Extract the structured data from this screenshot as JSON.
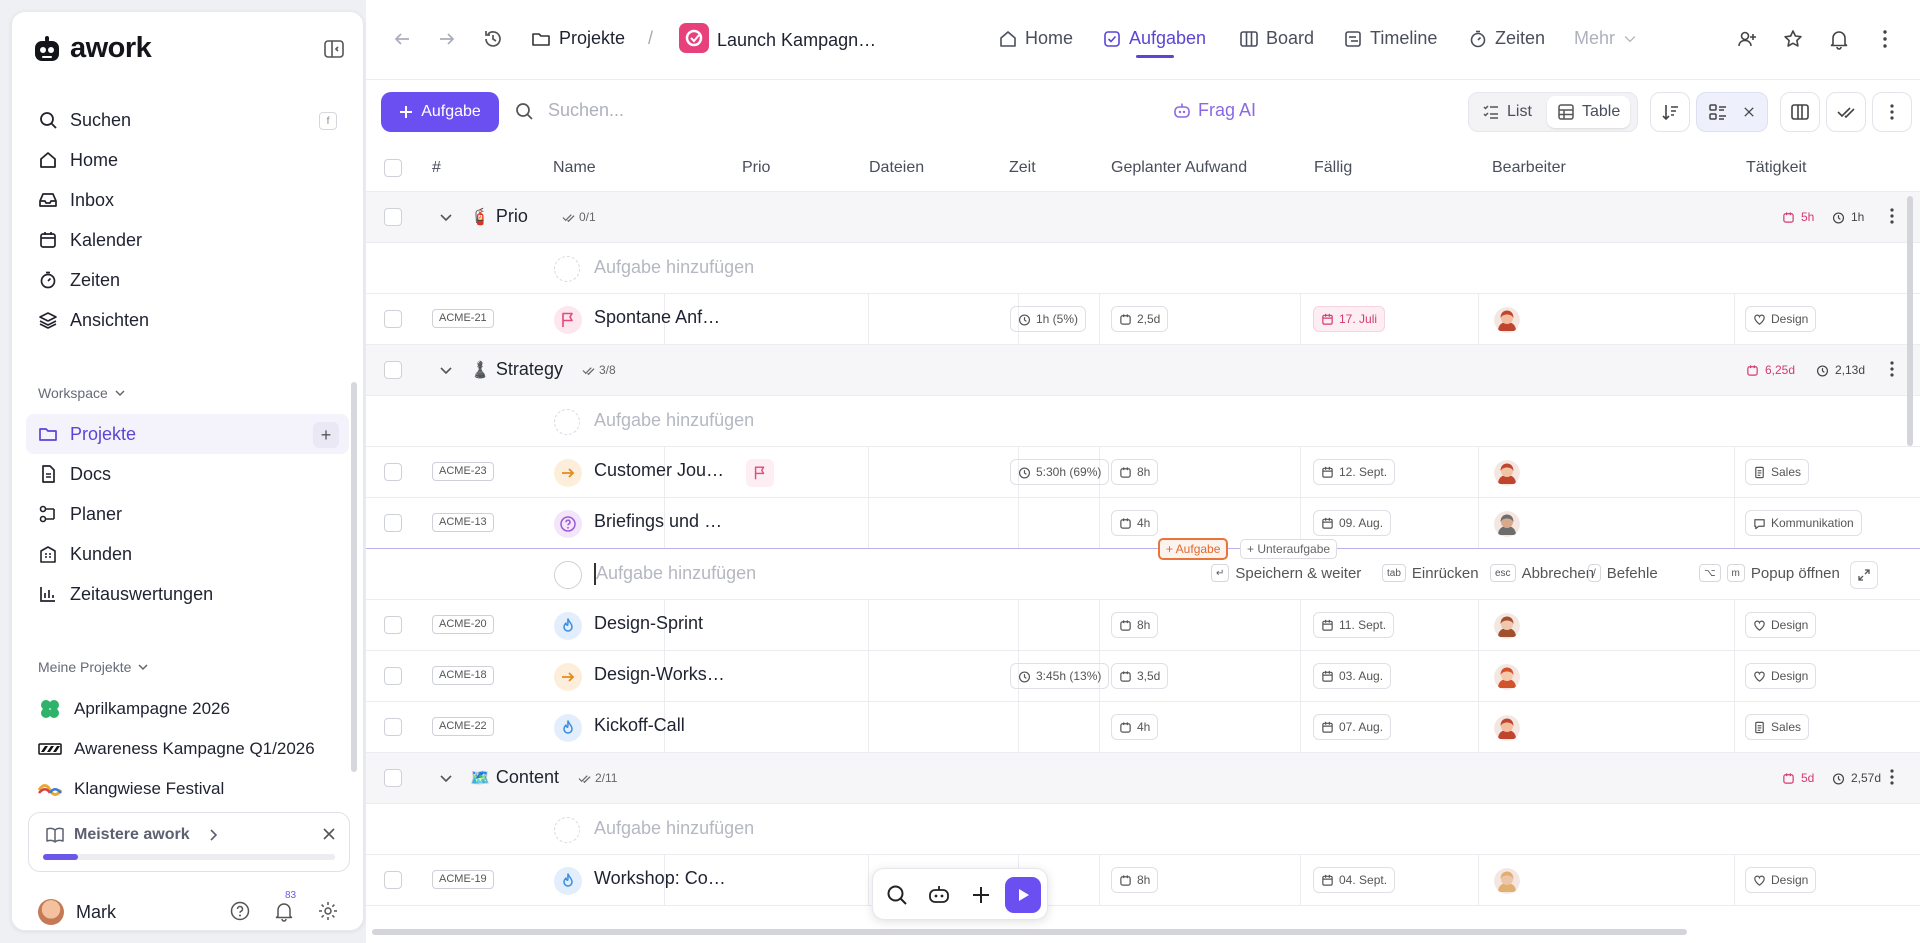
{
  "brand": {
    "name": "awork"
  },
  "sidebar": {
    "search": {
      "label": "Suchen",
      "shortcut": "f"
    },
    "items": [
      {
        "label": "Home",
        "icon": "home-icon"
      },
      {
        "label": "Inbox",
        "icon": "inbox-icon"
      },
      {
        "label": "Kalender",
        "icon": "calendar-icon"
      },
      {
        "label": "Zeiten",
        "icon": "timer-icon"
      },
      {
        "label": "Ansichten",
        "icon": "layers-icon"
      }
    ],
    "workspace_label": "Workspace",
    "workspace_items": [
      {
        "label": "Projekte",
        "icon": "folder-icon",
        "active": true
      },
      {
        "label": "Docs",
        "icon": "doc-icon"
      },
      {
        "label": "Planer",
        "icon": "planner-icon"
      },
      {
        "label": "Kunden",
        "icon": "building-icon"
      },
      {
        "label": "Zeitauswertungen",
        "icon": "chart-icon"
      }
    ],
    "my_projects_label": "Meine Projekte",
    "projects": [
      {
        "label": "Aprilkampagne 2026",
        "color": "#2fb36b"
      },
      {
        "label": "Awareness Kampagne Q1/2026",
        "color": "#111111"
      },
      {
        "label": "Klangwiese Festival",
        "color": "#e8a93a"
      }
    ],
    "master": {
      "title": "Meistere awork",
      "progress": 0.12
    },
    "user": {
      "name": "Mark",
      "notifications": "83"
    }
  },
  "topbar": {
    "crumb_projects": "Projekte",
    "separator": "/",
    "project": "Launch Kampagn…",
    "tabs": [
      {
        "label": "Home",
        "icon": "home-icon"
      },
      {
        "label": "Aufgaben",
        "icon": "task-icon",
        "active": true
      },
      {
        "label": "Board",
        "icon": "board-icon"
      },
      {
        "label": "Timeline",
        "icon": "timeline-icon"
      },
      {
        "label": "Zeiten",
        "icon": "timer-icon"
      },
      {
        "label": "Mehr",
        "icon": "chevron-down-icon"
      }
    ]
  },
  "toolbar": {
    "add_label": "Aufgabe",
    "search_placeholder": "Suchen...",
    "ai_label": "Frag AI",
    "view_list": "List",
    "view_table": "Table"
  },
  "table": {
    "columns": [
      "#",
      "Name",
      "Prio",
      "Dateien",
      "Zeit",
      "Geplanter Aufwand",
      "Fällig",
      "Bearbeiter",
      "Tätigkeit"
    ],
    "add_task": "Aufgabe hinzufügen",
    "groups": [
      {
        "title": "Prio",
        "emoji": "🧯",
        "count": "0/1",
        "planned": "5h",
        "time": "1h"
      },
      {
        "title": "Strategy",
        "emoji": "♟️",
        "count": "3/8",
        "planned": "6,25d",
        "time": "2,13d"
      },
      {
        "title": "Content",
        "emoji": "🗺️",
        "count": "2/11",
        "planned": "5d",
        "time": "2,57d"
      }
    ],
    "tasks": [
      {
        "key": "ACME-21",
        "name": "Spontane Anf…",
        "time": "1h (5%)",
        "effort": "2,5d",
        "due": "17. Juli",
        "due_red": true,
        "activity": "Design"
      },
      {
        "key": "ACME-23",
        "name": "Customer Jou…",
        "flag": true,
        "time": "5:30h (69%)",
        "effort": "8h",
        "due": "12. Sept.",
        "activity": "Sales"
      },
      {
        "key": "ACME-13",
        "name": "Briefings und …",
        "effort": "4h",
        "due": "09. Aug.",
        "activity": "Kommunikation"
      },
      {
        "key": "ACME-20",
        "name": "Design-Sprint",
        "effort": "8h",
        "due": "11. Sept.",
        "activity": "Design"
      },
      {
        "key": "ACME-18",
        "name": "Design-Works…",
        "time": "3:45h (13%)",
        "effort": "3,5d",
        "due": "03. Aug.",
        "activity": "Design"
      },
      {
        "key": "ACME-22",
        "name": "Kickoff-Call",
        "effort": "4h",
        "due": "07. Aug.",
        "activity": "Sales"
      },
      {
        "key": "ACME-19",
        "name": "Workshop: Co…",
        "effort": "8h",
        "due": "04. Sept.",
        "activity": "Design"
      }
    ],
    "insert": {
      "task": "+ Aufgabe",
      "subtask": "+ Unteraufgabe"
    },
    "hints": {
      "save": "Speichern & weiter",
      "indent": "Einrücken",
      "cancel": "Abbrechen",
      "commands": "Befehle",
      "popup": "Popup öffnen",
      "tab_key": "tab",
      "esc_key": "esc",
      "slash_key": "/",
      "alt_key": "⌥",
      "m_key": "m",
      "enter_key": "↵"
    }
  }
}
